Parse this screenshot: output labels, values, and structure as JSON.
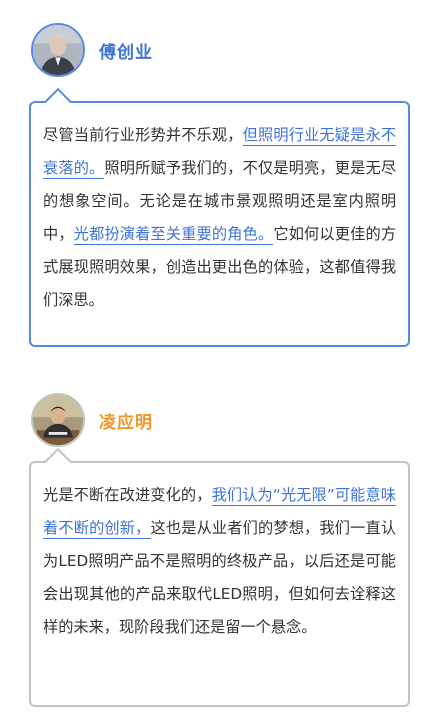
{
  "colors": {
    "accent_blue": "#3e72d6",
    "accent_orange": "#f0962a",
    "card1_border": "#5b8ae0",
    "card2_border": "#c4c4c4"
  },
  "posts": [
    {
      "author": "傅创业",
      "segments": [
        {
          "text": "尽管当前行业形势并不乐观，",
          "highlight": false
        },
        {
          "text": "但照明行业无疑是永不衰落的。",
          "highlight": true
        },
        {
          "text": "照明所赋予我们的，不仅是明亮，更是无尽的想象空间。无论是在城市景观照明还是室内照明中，",
          "highlight": false
        },
        {
          "text": "光都扮演着至关重要的角色。",
          "highlight": true
        },
        {
          "text": "它如何以更佳的方式展现照明效果，创造出更出色的体验，这都值得我们深思。",
          "highlight": false
        }
      ]
    },
    {
      "author": "凌应明",
      "segments": [
        {
          "text": "光是不断在改进变化的，",
          "highlight": false
        },
        {
          "text": "我们认为“光无限”可能意味着不断的创新，",
          "highlight": true
        },
        {
          "text": "这也是从业者们的梦想，我们一直认为LED照明产品不是照明的终极产品，以后还是可能会出现其他的产品来取代LED照明，但如何去诠释这样的未来，现阶段我们还是留一个悬念。",
          "highlight": false
        }
      ]
    }
  ]
}
